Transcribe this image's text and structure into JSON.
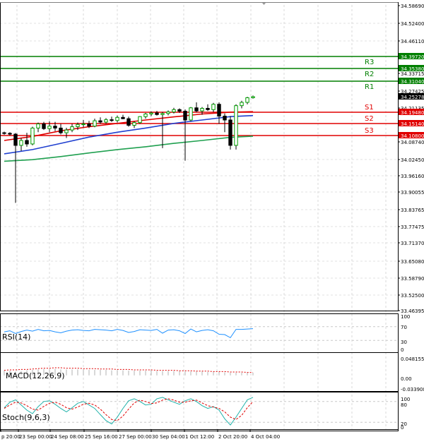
{
  "chart_data": {
    "type": "candlestick",
    "price_axis": {
      "ylim": [
        33.46395,
        34.5869
      ],
      "ticks": [
        "34.58690",
        "34.52400",
        "34.46110",
        "34.39720",
        "34.35380",
        "34.33715",
        "34.31040",
        "34.27425",
        "34.25278",
        "34.21135",
        "34.19480",
        "34.15140",
        "34.10800",
        "34.08740",
        "34.02450",
        "33.96160",
        "33.90055",
        "33.83765",
        "33.77475",
        "33.71370",
        "33.65080",
        "33.58790",
        "33.52500",
        "33.46395"
      ]
    },
    "levels": [
      {
        "name": "R3",
        "value": 34.3972,
        "color": "#007f00"
      },
      {
        "name": "R2",
        "value": 34.3538,
        "color": "#007f00"
      },
      {
        "name": "R1",
        "value": 34.3104,
        "color": "#007f00"
      },
      {
        "name": "S1",
        "value": 34.1948,
        "color": "#e00000"
      },
      {
        "name": "S2",
        "value": 34.1514,
        "color": "#e00000"
      },
      {
        "name": "S3",
        "value": 34.108,
        "color": "#e00000"
      }
    ],
    "current_price": "34.25278",
    "time_labels": [
      "p 20:00",
      "23 Sep 00:00",
      "24 Sep 08:00",
      "25 Sep 16:00",
      "27 Sep 00:00",
      "30 Sep 04:00",
      "1 Oct 12:00",
      "2 Oct 20:00",
      "4 Oct 04:00"
    ],
    "candles": [
      [
        34.118,
        34.122,
        34.111,
        34.116
      ],
      [
        34.116,
        34.12,
        34.108,
        34.113
      ],
      [
        34.113,
        34.117,
        33.862,
        34.075
      ],
      [
        34.075,
        34.1,
        34.055,
        34.092
      ],
      [
        34.092,
        34.118,
        34.07,
        34.08
      ],
      [
        34.08,
        34.14,
        34.075,
        34.135
      ],
      [
        34.135,
        34.155,
        34.12,
        34.15
      ],
      [
        34.15,
        34.158,
        34.128,
        34.133
      ],
      [
        34.133,
        34.16,
        34.12,
        34.142
      ],
      [
        34.142,
        34.158,
        34.124,
        34.135
      ],
      [
        34.135,
        34.15,
        34.112,
        34.118
      ],
      [
        34.118,
        34.136,
        34.1,
        34.128
      ],
      [
        34.128,
        34.15,
        34.12,
        34.14
      ],
      [
        34.14,
        34.155,
        34.128,
        34.148
      ],
      [
        34.148,
        34.165,
        34.138,
        34.15
      ],
      [
        34.15,
        34.162,
        34.135,
        34.142
      ],
      [
        34.142,
        34.17,
        34.138,
        34.162
      ],
      [
        34.162,
        34.175,
        34.15,
        34.157
      ],
      [
        34.157,
        34.172,
        34.15,
        34.166
      ],
      [
        34.166,
        34.178,
        34.158,
        34.163
      ],
      [
        34.163,
        34.182,
        34.155,
        34.175
      ],
      [
        34.175,
        34.185,
        34.168,
        34.17
      ],
      [
        34.17,
        34.178,
        34.14,
        34.145
      ],
      [
        34.145,
        34.16,
        34.135,
        34.155
      ],
      [
        34.155,
        34.18,
        34.15,
        34.178
      ],
      [
        34.178,
        34.192,
        34.17,
        34.188
      ],
      [
        34.188,
        34.198,
        34.18,
        34.192
      ],
      [
        34.192,
        34.2,
        34.182,
        34.186
      ],
      [
        34.186,
        34.196,
        34.065,
        34.19
      ],
      [
        34.19,
        34.202,
        34.183,
        34.196
      ],
      [
        34.196,
        34.212,
        34.19,
        34.205
      ],
      [
        34.205,
        34.21,
        34.192,
        34.199
      ],
      [
        34.199,
        34.206,
        34.02,
        34.165
      ],
      [
        34.165,
        34.215,
        34.16,
        34.212
      ],
      [
        34.212,
        34.232,
        34.195,
        34.2
      ],
      [
        34.2,
        34.215,
        34.185,
        34.21
      ],
      [
        34.21,
        34.225,
        34.2,
        34.205
      ],
      [
        34.205,
        34.23,
        34.195,
        34.225
      ],
      [
        34.225,
        34.232,
        34.15,
        34.18
      ],
      [
        34.18,
        34.19,
        34.12,
        34.165
      ],
      [
        34.165,
        34.18,
        34.06,
        34.075
      ],
      [
        34.075,
        34.225,
        34.06,
        34.22
      ],
      [
        34.22,
        34.238,
        34.21,
        34.232
      ],
      [
        34.232,
        34.252,
        34.225,
        34.249
      ],
      [
        34.249,
        34.257,
        34.246,
        34.253
      ]
    ],
    "moving_averages": [
      {
        "color": "#e00000",
        "values": [
          [
            0,
            34.092
          ],
          [
            5,
            34.105
          ],
          [
            10,
            34.125
          ],
          [
            15,
            34.14
          ],
          [
            20,
            34.152
          ],
          [
            25,
            34.165
          ],
          [
            30,
            34.177
          ],
          [
            35,
            34.188
          ],
          [
            40,
            34.195
          ],
          [
            44,
            34.197
          ]
        ]
      },
      {
        "color": "#2040d0",
        "values": [
          [
            0,
            34.045
          ],
          [
            5,
            34.06
          ],
          [
            10,
            34.082
          ],
          [
            15,
            34.103
          ],
          [
            20,
            34.12
          ],
          [
            25,
            34.135
          ],
          [
            30,
            34.152
          ],
          [
            35,
            34.165
          ],
          [
            40,
            34.178
          ],
          [
            44,
            34.182
          ]
        ]
      },
      {
        "color": "#20a050",
        "values": [
          [
            0,
            34.018
          ],
          [
            5,
            34.024
          ],
          [
            10,
            34.035
          ],
          [
            15,
            34.048
          ],
          [
            20,
            34.06
          ],
          [
            25,
            34.07
          ],
          [
            30,
            34.082
          ],
          [
            35,
            34.092
          ],
          [
            40,
            34.102
          ],
          [
            44,
            34.106
          ]
        ]
      }
    ],
    "rsi": {
      "label": "RSI(14)",
      "ticks": [
        "100",
        "70",
        "30",
        "0"
      ],
      "ylim": [
        0,
        100
      ],
      "values": [
        55,
        58,
        50,
        56,
        60,
        57,
        62,
        58,
        59,
        55,
        52,
        57,
        60,
        61,
        59,
        58,
        62,
        61,
        60,
        58,
        62,
        59,
        53,
        56,
        61,
        60,
        59,
        62,
        51,
        60,
        61,
        58,
        50,
        63,
        55,
        59,
        61,
        58,
        48,
        47,
        38,
        62,
        62,
        63,
        64
      ]
    },
    "macd": {
      "label": "MACD(12,26,9)",
      "ticks": [
        "0.048155",
        "0.00",
        "-0.033908"
      ],
      "ylim": [
        -0.033908,
        0.048155
      ],
      "hist": [
        0.012,
        0.011,
        0.009,
        0.01,
        0.012,
        0.013,
        0.014,
        0.015,
        0.015,
        0.015,
        0.014,
        0.014,
        0.014,
        0.014,
        0.014,
        0.013,
        0.013,
        0.013,
        0.013,
        0.012,
        0.012,
        0.012,
        0.011,
        0.011,
        0.011,
        0.011,
        0.011,
        0.01,
        0.01,
        0.01,
        0.01,
        0.01,
        0.009,
        0.009,
        0.009,
        0.009,
        0.008,
        0.008,
        0.008,
        0.007,
        0.006,
        0.006,
        0.006,
        0.006,
        0.006
      ],
      "signal": [
        0.012,
        0.013,
        0.013,
        0.014,
        0.014,
        0.015,
        0.016,
        0.017,
        0.017,
        0.018,
        0.018,
        0.017,
        0.017,
        0.017,
        0.016,
        0.016,
        0.016,
        0.015,
        0.015,
        0.015,
        0.014,
        0.014,
        0.014,
        0.013,
        0.013,
        0.013,
        0.013,
        0.012,
        0.012,
        0.012,
        0.012,
        0.011,
        0.011,
        0.011,
        0.01,
        0.01,
        0.01,
        0.009,
        0.009,
        0.009,
        0.008,
        0.008,
        0.008,
        0.007,
        0.007
      ]
    },
    "stoch": {
      "label": "Stoch(9,6,3)",
      "ticks": [
        "100",
        "80",
        "20",
        "0"
      ],
      "ylim": [
        0,
        100
      ],
      "main": [
        62,
        78,
        85,
        70,
        55,
        45,
        65,
        80,
        82,
        72,
        60,
        50,
        62,
        75,
        80,
        70,
        60,
        42,
        25,
        15,
        35,
        60,
        82,
        88,
        80,
        70,
        72,
        88,
        92,
        85,
        78,
        72,
        82,
        88,
        80,
        68,
        60,
        65,
        55,
        30,
        12,
        35,
        60,
        85,
        92
      ],
      "signal": [
        60,
        70,
        78,
        76,
        68,
        58,
        55,
        66,
        75,
        78,
        72,
        62,
        58,
        64,
        72,
        75,
        70,
        58,
        42,
        28,
        25,
        38,
        58,
        76,
        84,
        80,
        74,
        76,
        84,
        88,
        84,
        78,
        78,
        82,
        84,
        76,
        68,
        64,
        60,
        50,
        35,
        28,
        40,
        62,
        80
      ]
    }
  }
}
